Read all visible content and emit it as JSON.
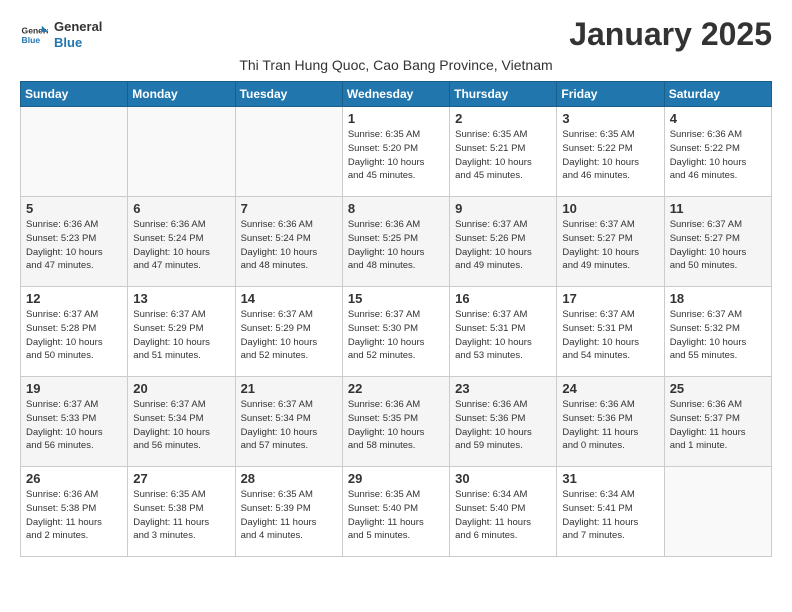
{
  "logo": {
    "line1": "General",
    "line2": "Blue"
  },
  "title": "January 2025",
  "subtitle": "Thi Tran Hung Quoc, Cao Bang Province, Vietnam",
  "days_of_week": [
    "Sunday",
    "Monday",
    "Tuesday",
    "Wednesday",
    "Thursday",
    "Friday",
    "Saturday"
  ],
  "weeks": [
    [
      {
        "day": "",
        "info": ""
      },
      {
        "day": "",
        "info": ""
      },
      {
        "day": "",
        "info": ""
      },
      {
        "day": "1",
        "info": "Sunrise: 6:35 AM\nSunset: 5:20 PM\nDaylight: 10 hours\nand 45 minutes."
      },
      {
        "day": "2",
        "info": "Sunrise: 6:35 AM\nSunset: 5:21 PM\nDaylight: 10 hours\nand 45 minutes."
      },
      {
        "day": "3",
        "info": "Sunrise: 6:35 AM\nSunset: 5:22 PM\nDaylight: 10 hours\nand 46 minutes."
      },
      {
        "day": "4",
        "info": "Sunrise: 6:36 AM\nSunset: 5:22 PM\nDaylight: 10 hours\nand 46 minutes."
      }
    ],
    [
      {
        "day": "5",
        "info": "Sunrise: 6:36 AM\nSunset: 5:23 PM\nDaylight: 10 hours\nand 47 minutes."
      },
      {
        "day": "6",
        "info": "Sunrise: 6:36 AM\nSunset: 5:24 PM\nDaylight: 10 hours\nand 47 minutes."
      },
      {
        "day": "7",
        "info": "Sunrise: 6:36 AM\nSunset: 5:24 PM\nDaylight: 10 hours\nand 48 minutes."
      },
      {
        "day": "8",
        "info": "Sunrise: 6:36 AM\nSunset: 5:25 PM\nDaylight: 10 hours\nand 48 minutes."
      },
      {
        "day": "9",
        "info": "Sunrise: 6:37 AM\nSunset: 5:26 PM\nDaylight: 10 hours\nand 49 minutes."
      },
      {
        "day": "10",
        "info": "Sunrise: 6:37 AM\nSunset: 5:27 PM\nDaylight: 10 hours\nand 49 minutes."
      },
      {
        "day": "11",
        "info": "Sunrise: 6:37 AM\nSunset: 5:27 PM\nDaylight: 10 hours\nand 50 minutes."
      }
    ],
    [
      {
        "day": "12",
        "info": "Sunrise: 6:37 AM\nSunset: 5:28 PM\nDaylight: 10 hours\nand 50 minutes."
      },
      {
        "day": "13",
        "info": "Sunrise: 6:37 AM\nSunset: 5:29 PM\nDaylight: 10 hours\nand 51 minutes."
      },
      {
        "day": "14",
        "info": "Sunrise: 6:37 AM\nSunset: 5:29 PM\nDaylight: 10 hours\nand 52 minutes."
      },
      {
        "day": "15",
        "info": "Sunrise: 6:37 AM\nSunset: 5:30 PM\nDaylight: 10 hours\nand 52 minutes."
      },
      {
        "day": "16",
        "info": "Sunrise: 6:37 AM\nSunset: 5:31 PM\nDaylight: 10 hours\nand 53 minutes."
      },
      {
        "day": "17",
        "info": "Sunrise: 6:37 AM\nSunset: 5:31 PM\nDaylight: 10 hours\nand 54 minutes."
      },
      {
        "day": "18",
        "info": "Sunrise: 6:37 AM\nSunset: 5:32 PM\nDaylight: 10 hours\nand 55 minutes."
      }
    ],
    [
      {
        "day": "19",
        "info": "Sunrise: 6:37 AM\nSunset: 5:33 PM\nDaylight: 10 hours\nand 56 minutes."
      },
      {
        "day": "20",
        "info": "Sunrise: 6:37 AM\nSunset: 5:34 PM\nDaylight: 10 hours\nand 56 minutes."
      },
      {
        "day": "21",
        "info": "Sunrise: 6:37 AM\nSunset: 5:34 PM\nDaylight: 10 hours\nand 57 minutes."
      },
      {
        "day": "22",
        "info": "Sunrise: 6:36 AM\nSunset: 5:35 PM\nDaylight: 10 hours\nand 58 minutes."
      },
      {
        "day": "23",
        "info": "Sunrise: 6:36 AM\nSunset: 5:36 PM\nDaylight: 10 hours\nand 59 minutes."
      },
      {
        "day": "24",
        "info": "Sunrise: 6:36 AM\nSunset: 5:36 PM\nDaylight: 11 hours\nand 0 minutes."
      },
      {
        "day": "25",
        "info": "Sunrise: 6:36 AM\nSunset: 5:37 PM\nDaylight: 11 hours\nand 1 minute."
      }
    ],
    [
      {
        "day": "26",
        "info": "Sunrise: 6:36 AM\nSunset: 5:38 PM\nDaylight: 11 hours\nand 2 minutes."
      },
      {
        "day": "27",
        "info": "Sunrise: 6:35 AM\nSunset: 5:38 PM\nDaylight: 11 hours\nand 3 minutes."
      },
      {
        "day": "28",
        "info": "Sunrise: 6:35 AM\nSunset: 5:39 PM\nDaylight: 11 hours\nand 4 minutes."
      },
      {
        "day": "29",
        "info": "Sunrise: 6:35 AM\nSunset: 5:40 PM\nDaylight: 11 hours\nand 5 minutes."
      },
      {
        "day": "30",
        "info": "Sunrise: 6:34 AM\nSunset: 5:40 PM\nDaylight: 11 hours\nand 6 minutes."
      },
      {
        "day": "31",
        "info": "Sunrise: 6:34 AM\nSunset: 5:41 PM\nDaylight: 11 hours\nand 7 minutes."
      },
      {
        "day": "",
        "info": ""
      }
    ]
  ]
}
